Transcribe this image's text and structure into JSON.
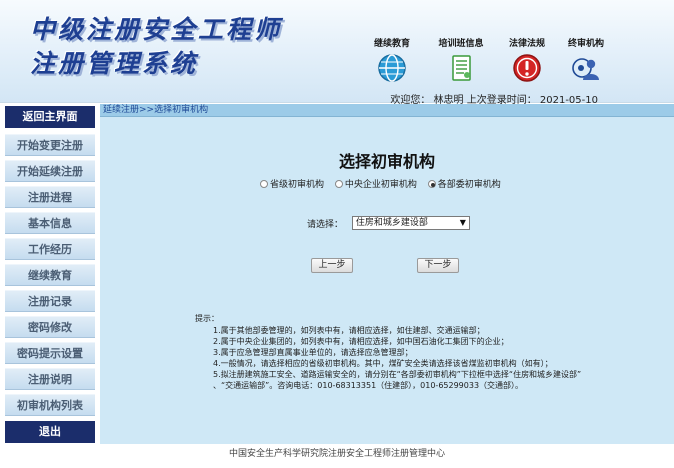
{
  "header": {
    "title_line_1": "中级注册安全工程师",
    "title_line_2": "注册管理系统",
    "nav_icons": [
      {
        "label": "继续教育",
        "icon": "globe-icon"
      },
      {
        "label": "培训班信息",
        "icon": "document-icon"
      },
      {
        "label": "法律法规",
        "icon": "alert-icon"
      },
      {
        "label": "终审机构",
        "icon": "user-group-icon"
      }
    ],
    "welcome_text": "欢迎您：  林忠明   上次登录时间：  2021-05-10"
  },
  "sidebar": {
    "items": [
      {
        "label": "返回主界面"
      },
      {
        "label": "开始变更注册"
      },
      {
        "label": "开始延续注册"
      },
      {
        "label": "注册进程"
      },
      {
        "label": "基本信息"
      },
      {
        "label": "工作经历"
      },
      {
        "label": "继续教育"
      },
      {
        "label": "注册记录"
      },
      {
        "label": "密码修改"
      },
      {
        "label": "密码提示设置"
      },
      {
        "label": "注册说明"
      },
      {
        "label": "初审机构列表"
      },
      {
        "label": "退出"
      }
    ]
  },
  "main": {
    "breadcrumb": "延续注册>>选择初审机构",
    "title": "选择初审机构",
    "radio_options": [
      {
        "label": "省级初审机构",
        "checked": false
      },
      {
        "label": "中央企业初审机构",
        "checked": false
      },
      {
        "label": "各部委初审机构",
        "checked": true
      }
    ],
    "select_label": "请选择：",
    "select_value": "住房和城乡建设部",
    "prev_button": "上一步",
    "next_button": "下一步",
    "tips_title": "提示：",
    "tips": [
      "1.属于其他部委管理的，如列表中有，请相应选择，如住建部、交通运输部；",
      "2.属于中央企业集团的，如列表中有，请相应选择，如中国石油化工集团下的企业；",
      "3.属于应急管理部直属事业单位的，请选择应急管理部；",
      "4.一般情况，请选择相应的省级初审机构。其中，煤矿安全类请选择该省煤监初审机构（如有）；",
      "5.拟注册建筑施工安全、道路运输安全的，请分别在“各部委初审机构”下拉框中选择“住房和城乡建设部”"
    ],
    "tips_continuation": "、“交通运输部”。咨询电话：010-68313351（住建部），010-65299033（交通部）。"
  },
  "footer": {
    "text": "中国安全生产科学研究院注册安全工程师注册管理中心"
  },
  "colors": {
    "title_blue": "#1e3f92",
    "sidebar_dark": "#1b2d6b",
    "main_bg": "#cfe8f6",
    "breadcrumb_bar": "#9ccbe8"
  }
}
